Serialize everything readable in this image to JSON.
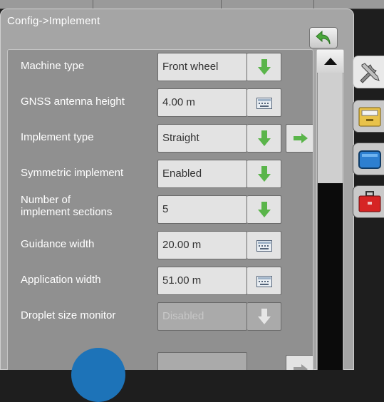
{
  "header": {
    "breadcrumb": "Config->Implement",
    "back_icon": "back-arrow-icon",
    "colors": {
      "panel": "#a5a5a5",
      "value_field": "#e3e3e3",
      "green_arrow": "#5ab54a",
      "marker": "#1d73b8"
    }
  },
  "top_strip": {
    "cells": [
      "",
      "",
      ""
    ]
  },
  "settings": [
    {
      "label": "Machine type",
      "value": "Front wheel",
      "control": "dropdown",
      "enabled": true,
      "has_next": false
    },
    {
      "label": "GNSS antenna height",
      "value": "4.00 m",
      "control": "keyboard",
      "enabled": true,
      "has_next": false
    },
    {
      "label": "Implement type",
      "value": "Straight",
      "control": "dropdown",
      "enabled": true,
      "has_next": true
    },
    {
      "label": "Symmetric implement",
      "value": "Enabled",
      "control": "dropdown",
      "enabled": true,
      "has_next": false
    },
    {
      "label": "Number of",
      "label2": "implement sections",
      "value": "5",
      "control": "dropdown",
      "enabled": true,
      "has_next": false
    },
    {
      "label": "Guidance width",
      "value": "20.00 m",
      "control": "keyboard",
      "enabled": true,
      "has_next": false
    },
    {
      "label": "Application width",
      "value": "51.00 m",
      "control": "keyboard",
      "enabled": true,
      "has_next": false
    },
    {
      "label": "Droplet size monitor",
      "value": "Disabled",
      "control": "dropdown",
      "enabled": false,
      "has_next": false
    },
    {
      "label": "",
      "value": "",
      "control": "none",
      "enabled": false,
      "has_next": true
    }
  ],
  "side_tabs": [
    {
      "name": "tools-icon",
      "active": true
    },
    {
      "name": "console-icon",
      "active": false
    },
    {
      "name": "display-icon",
      "active": false
    },
    {
      "name": "toolbox-icon",
      "active": false
    }
  ],
  "scrollbar": {
    "up_icon": "scroll-up-icon"
  }
}
